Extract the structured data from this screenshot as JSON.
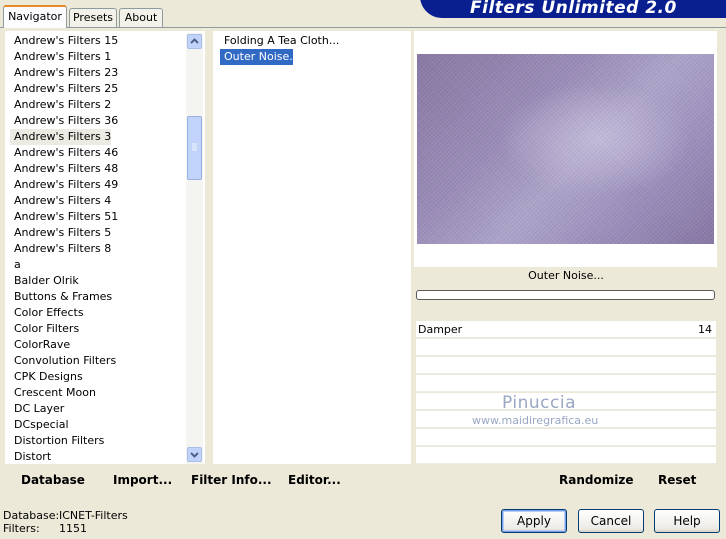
{
  "tabs": [
    "Navigator",
    "Presets",
    "About"
  ],
  "banner": "Filters Unlimited 2.0",
  "categories": [
    "Andrew's Filters 15",
    "Andrew's Filters 1",
    "Andrew's Filters 23",
    "Andrew's Filters 25",
    "Andrew's Filters 2",
    "Andrew's Filters 36",
    "Andrew's Filters 3",
    "Andrew's Filters 46",
    "Andrew's Filters 48",
    "Andrew's Filters 49",
    "Andrew's Filters 4",
    "Andrew's Filters 51",
    "Andrew's Filters 5",
    "Andrew's Filters 8",
    "a",
    "Balder Olrik",
    "Buttons & Frames",
    "Color Effects",
    "Color Filters",
    "ColorRave",
    "Convolution Filters",
    "CPK Designs",
    "Crescent Moon",
    "DC Layer",
    "DCspecial",
    "Distortion Filters",
    "Distort"
  ],
  "selected_category": "Andrew's Filters 3",
  "filters": [
    "Folding A Tea Cloth...",
    "Outer Noise..."
  ],
  "selected_filter": "Outer Noise...",
  "left_toolbar": {
    "database": "Database",
    "import": "Import...",
    "filter_info": "Filter Info...",
    "editor": "Editor..."
  },
  "preview": {
    "filter_name": "Outer Noise...",
    "progress": 0
  },
  "params": [
    {
      "name": "Damper",
      "value": "14"
    }
  ],
  "right_toolbar": {
    "randomize": "Randomize",
    "reset": "Reset"
  },
  "watermark": {
    "line1": "Pinuccia",
    "line2": "www.maidiregrafica.eu"
  },
  "status": {
    "database_label": "Database:",
    "database_value": "ICNET-Filters",
    "filters_label": "Filters:",
    "filters_value": "1151"
  },
  "buttons": {
    "apply": "Apply",
    "cancel": "Cancel",
    "help": "Help"
  }
}
